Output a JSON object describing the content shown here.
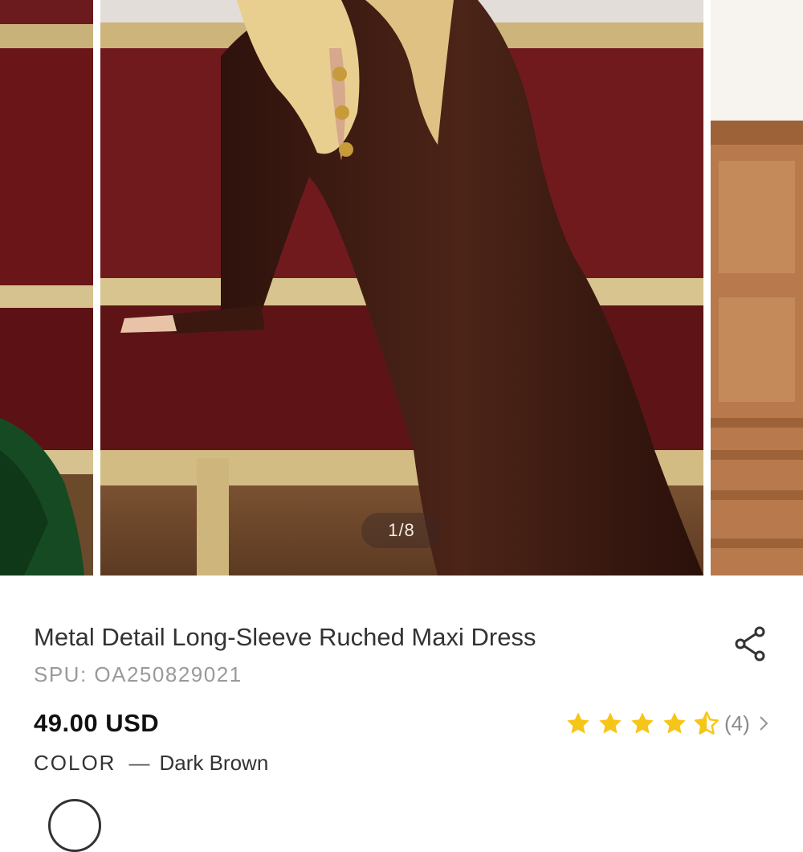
{
  "gallery": {
    "counter": "1/8",
    "slides": [
      "green-dress-photo",
      "brown-dress-photo",
      "wood-panel-photo"
    ]
  },
  "product": {
    "title": "Metal Detail Long-Sleeve Ruched Maxi Dress",
    "spu": "SPU: OA250829021",
    "price": "49.00 USD",
    "rating": {
      "value": 4.5,
      "max": 5,
      "count": "(4)"
    },
    "color_label": "COLOR",
    "color_separator": "—",
    "color_value": "Dark Brown"
  },
  "icons": {
    "share": "share-icon",
    "star": "star-icon",
    "chevron": "chevron-right-icon"
  },
  "colors": {
    "star": "#f5c518",
    "text": "#333333",
    "muted": "#9a9a9a",
    "sofa": "#6e1a1e",
    "dress": "#3e1c14"
  }
}
